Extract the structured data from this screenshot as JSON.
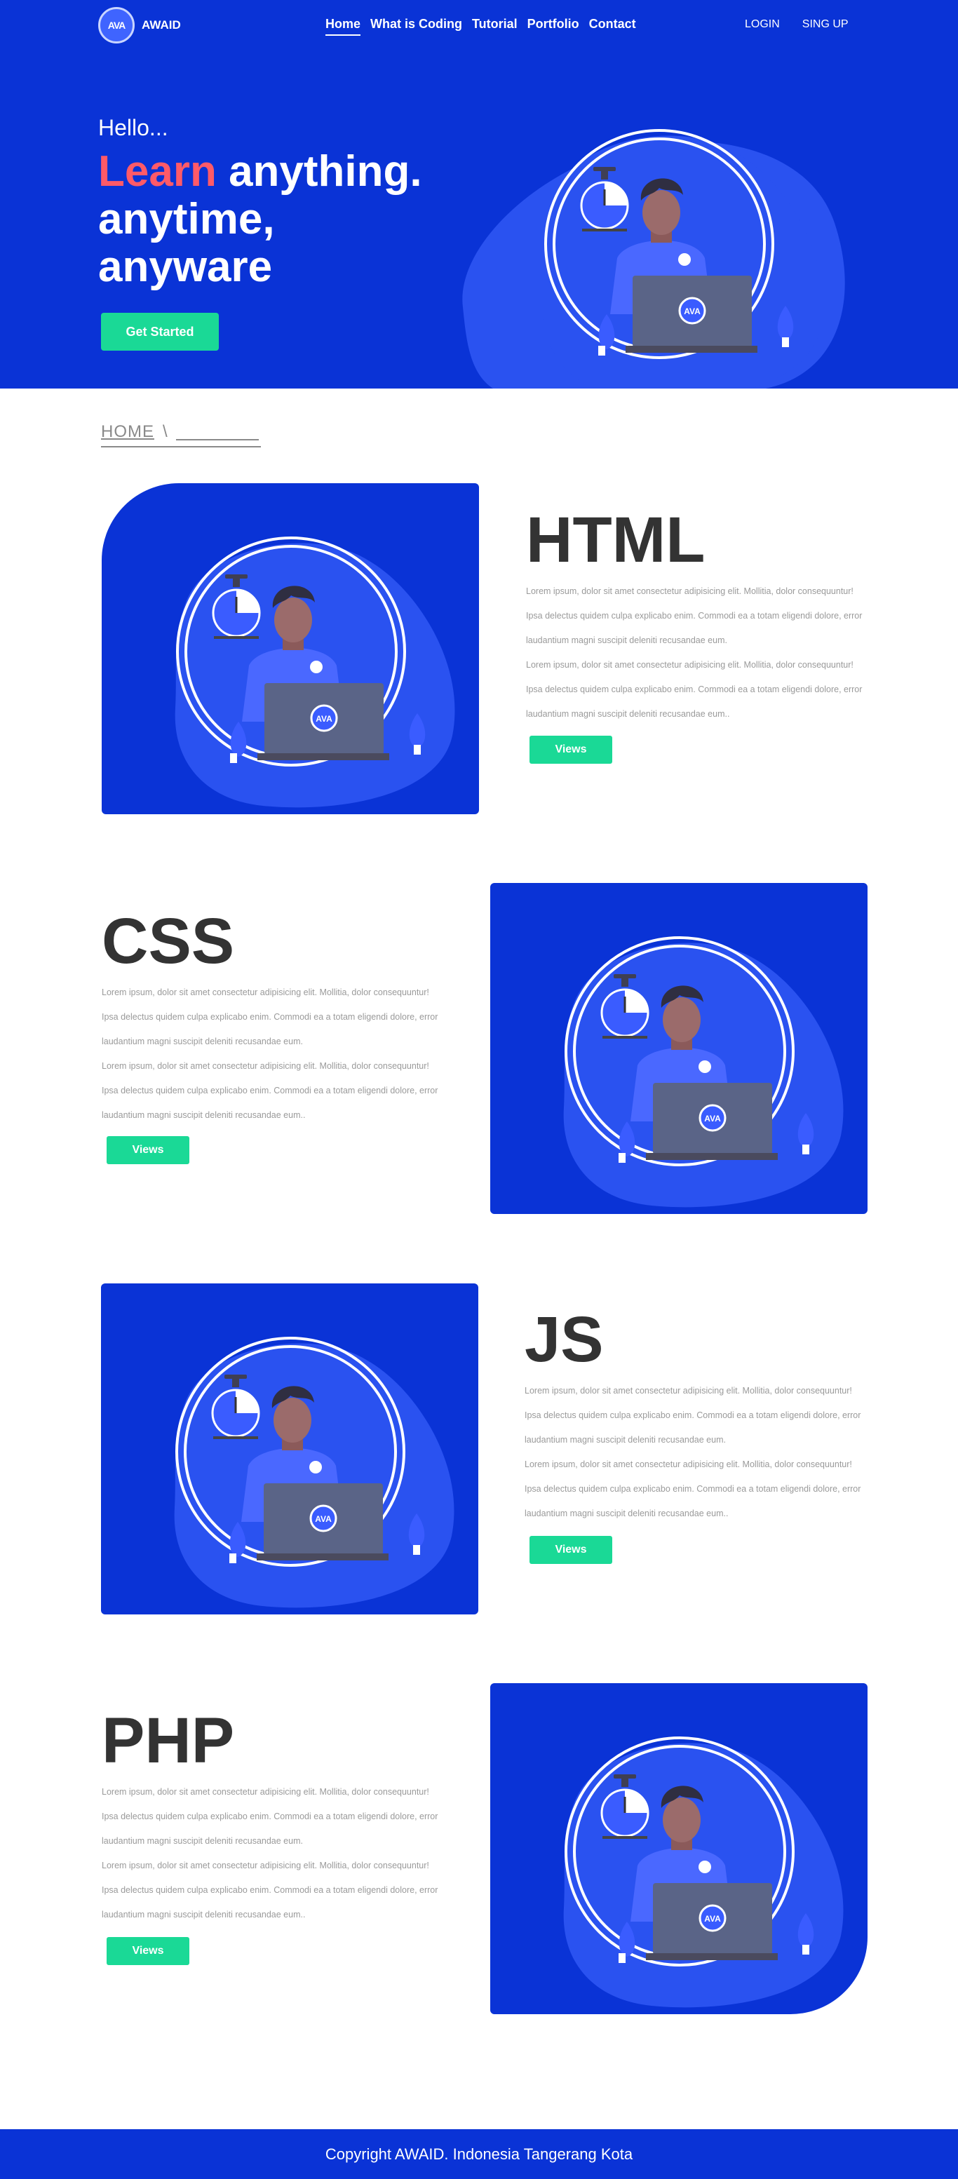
{
  "brand": {
    "logo_text": "AWAID",
    "badge_text": "AVA"
  },
  "nav": {
    "links": [
      "Home",
      "What is Coding",
      "Tutorial",
      "Portfolio",
      "Contact"
    ],
    "login": "LOGIN",
    "signup": "SING UP"
  },
  "hero": {
    "greeting": "Hello...",
    "accent_word": "Learn",
    "line1_rest": "anything.",
    "line2": "anytime,",
    "line3": "anyware",
    "cta": "Get Started"
  },
  "breadcrumb": {
    "home": "HOME",
    "separator": "\\"
  },
  "lorem": {
    "l1": "Lorem ipsum, dolor sit amet consectetur adipisicing elit. Mollitia, dolor consequuntur!",
    "l2": "Ipsa delectus quidem culpa explicabo enim. Commodi ea a totam eligendi dolore, error",
    "l3": "laudantium magni suscipit deleniti recusandae eum.",
    "l4": "Lorem ipsum, dolor sit amet consectetur adipisicing elit. Mollitia, dolor consequuntur!",
    "l5": "Ipsa delectus quidem culpa explicabo enim. Commodi ea a totam eligendi dolore, error",
    "l6": "laudantium magni suscipit deleniti recusandae eum.."
  },
  "sections": [
    {
      "title": "HTML",
      "button": "Views"
    },
    {
      "title": "CSS",
      "button": "Views"
    },
    {
      "title": "JS",
      "button": "Views"
    },
    {
      "title": "PHP",
      "button": "Views"
    }
  ],
  "footer": {
    "copyright": "Copyright AWAID. Indonesia Tangerang Kota"
  },
  "colors": {
    "primary": "#0a33d6",
    "accent": "#1ad996",
    "highlight": "#ff5a68",
    "title": "#333333"
  }
}
